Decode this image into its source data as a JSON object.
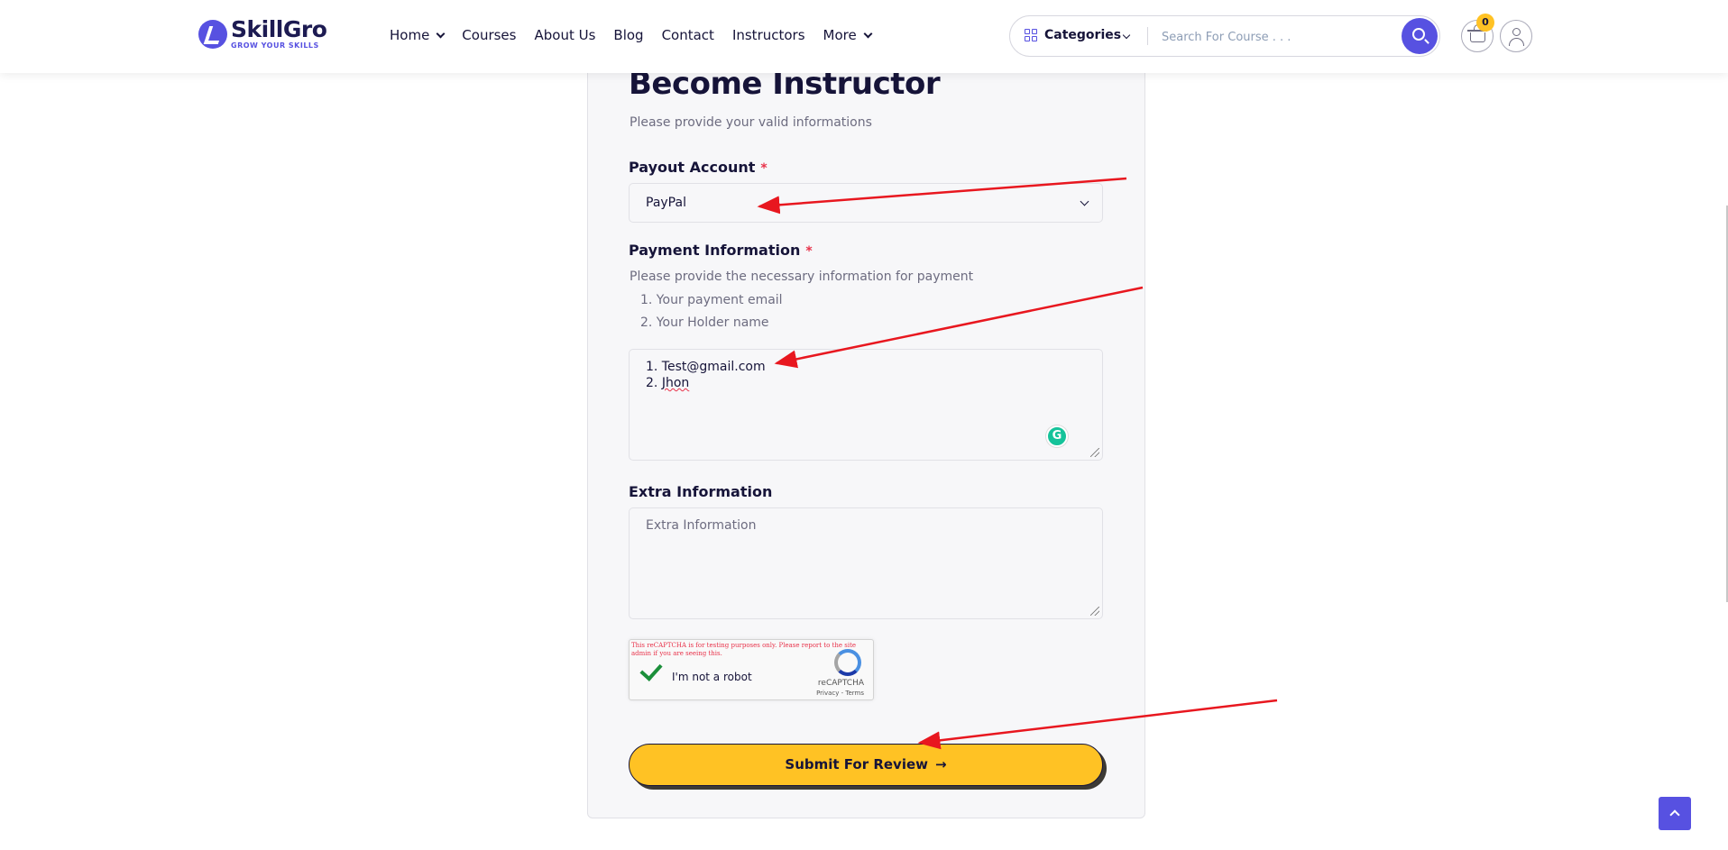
{
  "brand": {
    "name": "SkillGro",
    "tagline": "GROW YOUR SKILLS"
  },
  "nav": {
    "items": [
      {
        "label": "Home",
        "dropdown": true
      },
      {
        "label": "Courses",
        "dropdown": false
      },
      {
        "label": "About Us",
        "dropdown": false
      },
      {
        "label": "Blog",
        "dropdown": false
      },
      {
        "label": "Contact",
        "dropdown": false
      },
      {
        "label": "Instructors",
        "dropdown": false
      },
      {
        "label": "More",
        "dropdown": true
      }
    ]
  },
  "search": {
    "category_label": "Categories",
    "placeholder": "Search For Course . . ."
  },
  "cart": {
    "count": "0"
  },
  "form": {
    "title": "Become Instructor",
    "subtitle": "Please provide your valid informations",
    "payout": {
      "label": "Payout Account",
      "required_mark": "*",
      "selected": "PayPal"
    },
    "payment": {
      "label": "Payment Information",
      "required_mark": "*",
      "help": "Please provide the necessary information for payment",
      "help_items": [
        "1. Your payment email",
        "2. Your Holder name"
      ],
      "value_line1": "1. Test@gmail.com",
      "value_line2_prefix": "2. ",
      "value_line2_word": "Jhon"
    },
    "extra": {
      "label": "Extra Information",
      "placeholder": "Extra Information"
    },
    "captcha": {
      "warning": "This reCAPTCHA is for testing purposes only. Please report to the site admin if you are seeing this.",
      "label": "I'm not a robot",
      "brand": "reCAPTCHA",
      "links": "Privacy - Terms"
    },
    "submit_label": "Submit For Review"
  },
  "annotation_color": "#e8171f",
  "accent_color": "#5751e1",
  "button_color": "#ffc224"
}
